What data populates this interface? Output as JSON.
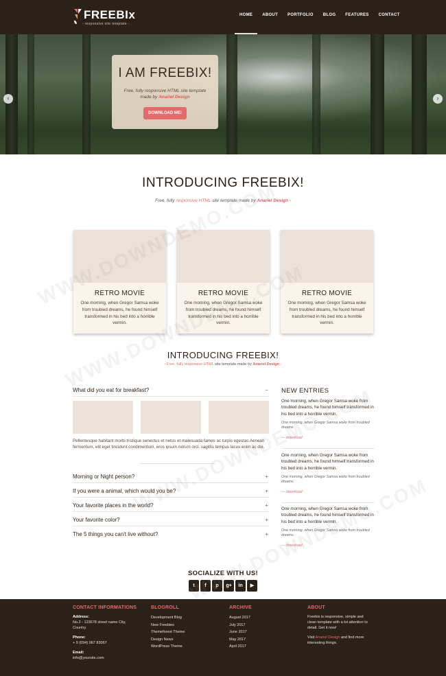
{
  "brand": {
    "name": "FREEBIx",
    "tagline": "- responsive site template -"
  },
  "nav": {
    "items": [
      "HOME",
      "ABOUT",
      "PORTFOLIO",
      "BLOG",
      "FEATURES",
      "CONTACT"
    ]
  },
  "hero": {
    "title": "I AM FREEBIX!",
    "text_before": "Free, fully responsive HTML site template made by ",
    "author": "Anariel Design",
    "button": "DOWNLOAD ME!"
  },
  "intro": {
    "title": "INTRODUCING FREEBIX!",
    "sub_free": "Free, fully ",
    "sub_link": "responsive HTML",
    "sub_mid": " site template made by ",
    "sub_author": "Anariel Design",
    "sub_arrow": " ›"
  },
  "cards": [
    {
      "title": "RETRO MOVIE",
      "text": "One morning, when Gregor Samsa woke from troubled dreams, he found himself transformed in his bed into a horrible vermin."
    },
    {
      "title": "RETRO MOVIE",
      "text": "One morning, when Gregor Samsa woke from troubled dreams, he found himself transformed in his bed into a horrible vermin."
    },
    {
      "title": "RETRO MOVIE",
      "text": "One morning, when Gregor Samsa woke from troubled dreams, he found himself transformed in his bed into a horrible vermin."
    }
  ],
  "intro2": {
    "title": "INTRODUCING FREEBIX!",
    "sub_pre": "‹ Free, fully ",
    "sub_link": "responsive HTML",
    "sub_mid": " site template made by ",
    "sub_author": "Anariel Design",
    "sub_arrow": " ›"
  },
  "accordion": {
    "open": {
      "question": "What did you eat for breakfast?",
      "sign": "−",
      "text": "Pellentesque habitant morbi tristique senectus et netus et malesuada fames ac turpis egestas.Aenean fermentum, elit eget tincidunt condimentum, eros ipsum rutrum orci, sagittis tempus lacus enim ac dui."
    },
    "items": [
      {
        "question": "Morning or Night person?",
        "sign": "+"
      },
      {
        "question": "If you were a animal, which would you be?",
        "sign": "+"
      },
      {
        "question": "Your favorite places in the world?",
        "sign": "+"
      },
      {
        "question": "Your favorite color?",
        "sign": "+"
      },
      {
        "question": "The 5 things you can't live without?",
        "sign": "+"
      }
    ]
  },
  "new_entries": {
    "title": "NEW ENTRIES",
    "entries": [
      {
        "main": "One morning, when Gregor Samsa woke from troubled dreams, he found himself transformed in his bed into a horrible vermin.",
        "meta": "One morning, when Gregor Samsa woke from troubled dreams",
        "link": "— download"
      },
      {
        "main": "One morning, when Gregor Samsa woke from troubled dreams, he found himself transformed in his bed into a horrible vermin.",
        "meta": "One morning, when Gregor Samsa woke from troubled dreams",
        "link": "— download"
      },
      {
        "main": "One morning, when Gregor Samsa woke from troubled dreams, he found himself transformed in his bed into a horrible vermin.",
        "meta": "One morning, when Gregor Samsa woke from troubled dreams",
        "link": "— download"
      }
    ]
  },
  "social": {
    "title": "SOCIALIZE WITH US!",
    "icons": [
      {
        "name": "twitter-icon",
        "glyph": "t"
      },
      {
        "name": "facebook-icon",
        "glyph": "f"
      },
      {
        "name": "pinterest-icon",
        "glyph": "p"
      },
      {
        "name": "google-plus-icon",
        "glyph": "g+"
      },
      {
        "name": "linkedin-icon",
        "glyph": "in"
      },
      {
        "name": "youtube-icon",
        "glyph": "▶"
      }
    ]
  },
  "footer": {
    "contact": {
      "title": "CONTACT INFORMATIONS",
      "address_label": "Address:",
      "address": "No.2 - 123678 street name City, Country",
      "phone_label": "Phone:",
      "phone": "+ 9 (094) 067 83067",
      "email_label": "Email:",
      "email": "info@yoursite.com"
    },
    "blogroll": {
      "title": "BLOGROLL",
      "items": [
        "Development Blog",
        "New Freebies",
        "Themeforest Theme",
        "Design News",
        "WordPress Theme"
      ]
    },
    "archive": {
      "title": "ARCHIVE",
      "items": [
        "August 2017",
        "July 2017",
        "June 2017",
        "May 2017",
        "April 2017"
      ]
    },
    "about": {
      "title": "ABOUT",
      "text": "Freebix is responsive, simple and clean template with a lot attention to detail. Get it now!",
      "visit_pre": "Visit ",
      "visit_link": "Anariel Design",
      "visit_post": " and find more interesting things."
    }
  },
  "watermark": "WWW.DOWNDEMO.COM",
  "colors": {
    "dark": "#2b2118",
    "accent": "#e56b6b",
    "card": "#ebe1d6"
  }
}
